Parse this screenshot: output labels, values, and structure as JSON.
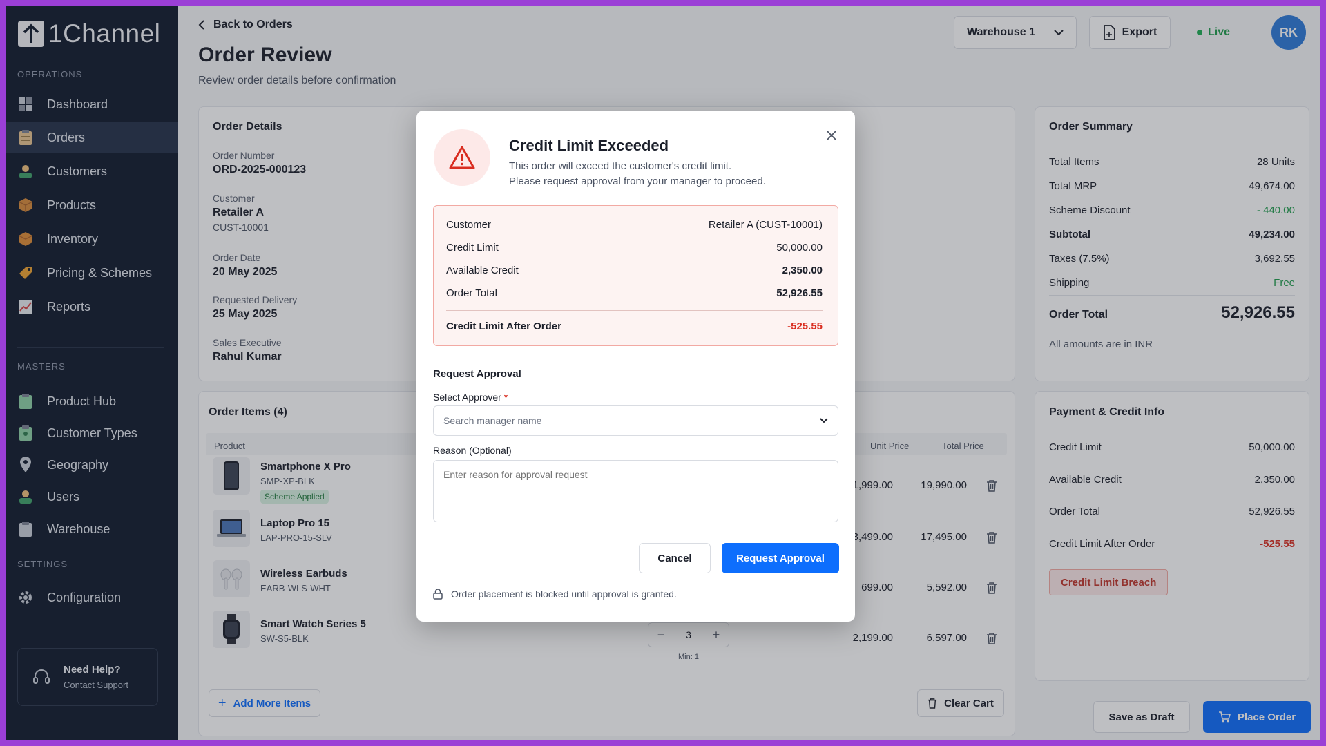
{
  "brand": {
    "name": "1Channel"
  },
  "sidebar": {
    "operations_label": "OPERATIONS",
    "masters_label": "MASTERS",
    "settings_label": "SETTINGS",
    "operations": [
      {
        "label": "Dashboard",
        "icon": "dashboard-icon"
      },
      {
        "label": "Orders",
        "icon": "clipboard-icon",
        "active": true
      },
      {
        "label": "Customers",
        "icon": "customers-icon"
      },
      {
        "label": "Products",
        "icon": "box-icon"
      },
      {
        "label": "Inventory",
        "icon": "inventory-icon"
      },
      {
        "label": "Pricing & Schemes",
        "icon": "tag-icon"
      },
      {
        "label": "Reports",
        "icon": "chart-icon"
      }
    ],
    "masters": [
      {
        "label": "Product Hub",
        "icon": "product-hub-icon"
      },
      {
        "label": "Customer Types",
        "icon": "customer-types-icon"
      },
      {
        "label": "Geography",
        "icon": "map-pin-icon"
      },
      {
        "label": "Users",
        "icon": "users-icon"
      },
      {
        "label": "Warehouse",
        "icon": "warehouse-icon"
      }
    ],
    "settings": [
      {
        "label": "Configuration",
        "icon": "gear-icon"
      }
    ],
    "help": {
      "title": "Need Help?",
      "subtitle": "Contact Support"
    }
  },
  "header": {
    "back_label": "Back to Orders",
    "title": "Order Review",
    "subtitle": "Review order details before confirmation",
    "warehouse": "Warehouse 1",
    "export_label": "Export",
    "status": "Live",
    "avatar_initials": "RK"
  },
  "order_details": {
    "title": "Order Details",
    "order_number_label": "Order Number",
    "order_number": "ORD-2025-000123",
    "customer_label": "Customer",
    "customer_name": "Retailer A",
    "customer_code": "CUST-10001",
    "order_date_label": "Order Date",
    "order_date": "20 May 2025",
    "delivery_label": "Requested Delivery",
    "delivery_date": "25 May 2025",
    "exec_label": "Sales Executive",
    "exec_name": "Rahul Kumar"
  },
  "order_items": {
    "title": "Order Items (4)",
    "col_product": "Product",
    "col_unit_price": "Unit Price",
    "col_total_price": "Total Price",
    "items": [
      {
        "name": "Smartphone X Pro",
        "sku": "SMP-XP-BLK",
        "badge": "Scheme Applied",
        "unit_price": "1,999.00",
        "total_price": "19,990.00"
      },
      {
        "name": "Laptop Pro 15",
        "sku": "LAP-PRO-15-SLV",
        "unit_price": "3,499.00",
        "total_price": "17,495.00"
      },
      {
        "name": "Wireless Earbuds",
        "sku": "EARB-WLS-WHT",
        "unit_price": "699.00",
        "total_price": "5,592.00"
      },
      {
        "name": "Smart Watch Series 5",
        "sku": "SW-S5-BLK",
        "unit_price": "2,199.00",
        "total_price": "6,597.00",
        "qty": "3",
        "min": "Min: 1"
      }
    ],
    "add_more_label": "Add More Items",
    "clear_cart_label": "Clear Cart"
  },
  "order_summary": {
    "title": "Order Summary",
    "rows": [
      {
        "label": "Total Items",
        "value": "28 Units"
      },
      {
        "label": "Total MRP",
        "value": "49,674.00"
      },
      {
        "label": "Scheme Discount",
        "value": "- 440.00"
      },
      {
        "label": "Subtotal",
        "value": "49,234.00"
      },
      {
        "label": "Taxes (7.5%)",
        "value": "3,692.55"
      },
      {
        "label": "Shipping",
        "value": "Free"
      }
    ],
    "total_label": "Order Total",
    "total_value": "52,926.55",
    "currency_note": "All amounts are in INR"
  },
  "payment": {
    "title": "Payment & Credit Info",
    "rows": [
      {
        "label": "Credit Limit",
        "value": "50,000.00"
      },
      {
        "label": "Available Credit",
        "value": "2,350.00"
      },
      {
        "label": "Order Total",
        "value": "52,926.55"
      },
      {
        "label": "Credit Limit After Order",
        "value": "-525.55"
      }
    ],
    "breach_badge": "Credit Limit Breach"
  },
  "footer": {
    "save_draft_label": "Save as Draft",
    "place_order_label": "Place Order"
  },
  "modal": {
    "title": "Credit Limit Exceeded",
    "desc_line1": "This order will exceed the customer's credit limit.",
    "desc_line2": "Please request approval from your manager to proceed.",
    "credit_rows": [
      {
        "label": "Customer",
        "value": "Retailer A (CUST-10001)"
      },
      {
        "label": "Credit Limit",
        "value": "50,000.00"
      },
      {
        "label": "Available Credit",
        "value": "2,350.00"
      },
      {
        "label": "Order Total",
        "value": "52,926.55"
      }
    ],
    "after_label": "Credit Limit After Order",
    "after_value": "-525.55",
    "request_title": "Request Approval",
    "approver_label": "Select Approver",
    "approver_required": "*",
    "approver_placeholder": "Search manager name",
    "reason_label": "Reason (Optional)",
    "reason_placeholder": "Enter reason for approval request",
    "cancel_label": "Cancel",
    "request_label": "Request Approval",
    "blocked_note": "Order placement is blocked until approval is granted."
  },
  "colors": {
    "sidebar_bg": "#111b2d",
    "primary": "#0d6efd",
    "danger": "#d92d20",
    "success": "#1f9d4c"
  }
}
